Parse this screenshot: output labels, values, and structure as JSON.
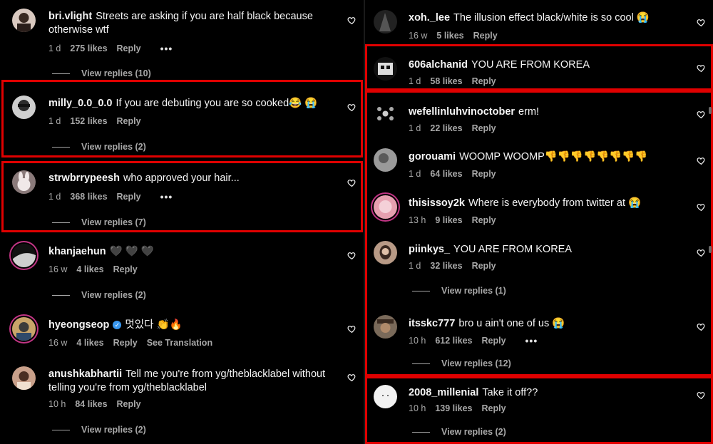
{
  "left": [
    {
      "user": "bri.vlight",
      "text": "Streets are asking if you are half black because otherwise wtf",
      "time": "1 d",
      "likes": "275 likes",
      "reply": "Reply",
      "dots": "•••",
      "view_replies": "View replies (10)",
      "avatar_color": "#d9c9c0"
    },
    {
      "user": "milly_0.0_0.0",
      "text": "If you are debuting you are so cooked😂 😭",
      "time": "1 d",
      "likes": "152 likes",
      "reply": "Reply",
      "view_replies": "View replies (2)",
      "avatar_color": "#cfcfcf"
    },
    {
      "user": "strwbrrypeesh",
      "text": "who approved your hair...",
      "time": "1 d",
      "likes": "368 likes",
      "reply": "Reply",
      "dots": "•••",
      "view_replies": "View replies (7)",
      "avatar_color": "#e8e0e0"
    },
    {
      "user": "khanjaehun",
      "text": "🖤 🖤 🖤",
      "time": "16 w",
      "likes": "4 likes",
      "reply": "Reply",
      "view_replies": "View replies (2)",
      "avatar_color": "#777777"
    },
    {
      "user": "hyeongseop",
      "text": "멋있다 👏🔥",
      "time": "16 w",
      "likes": "4 likes",
      "reply": "Reply",
      "see_translation": "See Translation",
      "avatar_color": "#c9a56a"
    },
    {
      "user": "anushkabhartii",
      "text": "Tell me you're from yg/theblacklabel without telling you're from yg/theblacklabel",
      "time": "10 h",
      "likes": "84 likes",
      "reply": "Reply",
      "view_replies": "View replies (2)",
      "avatar_color": "#c9a08a"
    }
  ],
  "right": [
    {
      "user": "xoh._lee",
      "text": "The illusion effect black/white is so cool 😭",
      "time": "16 w",
      "likes": "5 likes",
      "reply": "Reply",
      "avatar_color": "#555555"
    },
    {
      "user": "606alchanid",
      "text": "YOU ARE FROM KOREA",
      "time": "1 d",
      "likes": "58 likes",
      "reply": "Reply",
      "avatar_color": "#444444"
    },
    {
      "user": "wefellinluhvinoctober",
      "text": "erm!",
      "time": "1 d",
      "likes": "22 likes",
      "reply": "Reply",
      "avatar_color": "#999999"
    },
    {
      "user": "gorouami",
      "text": "WOOMP WOOMP👎👎👎👎👎👎👎👎",
      "time": "1 d",
      "likes": "64 likes",
      "reply": "Reply",
      "avatar_color": "#9a9a9a"
    },
    {
      "user": "thisissoy2k",
      "text": "Where is everybody from twitter at 😭",
      "time": "13 h",
      "likes": "9 likes",
      "reply": "Reply",
      "avatar_color": "#e6a0b0"
    },
    {
      "user": "piinkys_",
      "text": "YOU ARE FROM KOREA",
      "time": "1 d",
      "likes": "32 likes",
      "reply": "Reply",
      "view_replies": "View replies (1)",
      "avatar_color": "#b89a86"
    },
    {
      "user": "itsskc777",
      "text": "bro u ain't one of us 😭",
      "time": "10 h",
      "likes": "612 likes",
      "reply": "Reply",
      "dots": "•••",
      "view_replies": "View replies (12)",
      "avatar_color": "#7a6a5a"
    },
    {
      "user": "2008_millenial",
      "text": "Take it off??",
      "time": "10 h",
      "likes": "139 likes",
      "reply": "Reply",
      "view_replies": "View replies (2)",
      "avatar_color": "#f2f2f2"
    }
  ],
  "colors": {
    "highlight": "#e00000",
    "verified": "#3897f0",
    "muted": "#a8a8a8",
    "story_ring": "#c13584"
  },
  "icons": {
    "like": "heart-outline-icon",
    "verified": "verified-badge-icon",
    "more": "more-horizontal-icon"
  }
}
